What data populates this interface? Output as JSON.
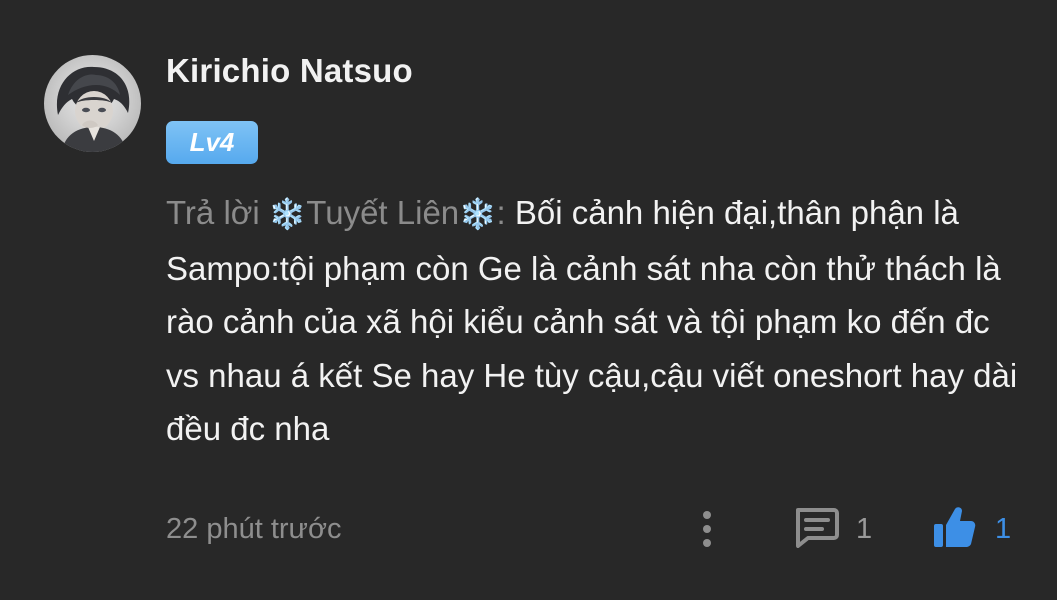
{
  "comment": {
    "username": "Kirichio Natsuo",
    "level": "Lv4",
    "reply_prefix": "Trả lời",
    "reply_target": "Tuyết Liên",
    "reply_separator": ":",
    "body": " Bối cảnh hiện đại,thân phận là Sampo:tội phạm còn Ge là cảnh sát nha còn thử thách là rào cảnh của xã hội kiểu cảnh sát và tội phạm ko đến đc vs nhau á kết Se hay He tùy cậu,cậu viết oneshort hay dài đều đc nha",
    "snowflake": "❄️",
    "timestamp": "22 phút trước",
    "reply_count": "1",
    "like_count": "1"
  },
  "icons": {
    "more": "more-vertical-icon",
    "reply": "comment-icon",
    "like": "thumbs-up-icon"
  },
  "colors": {
    "background": "#282828",
    "badge": "#5aabef",
    "like_accent": "#3d8fe6",
    "muted_text": "#8b8b8b"
  }
}
